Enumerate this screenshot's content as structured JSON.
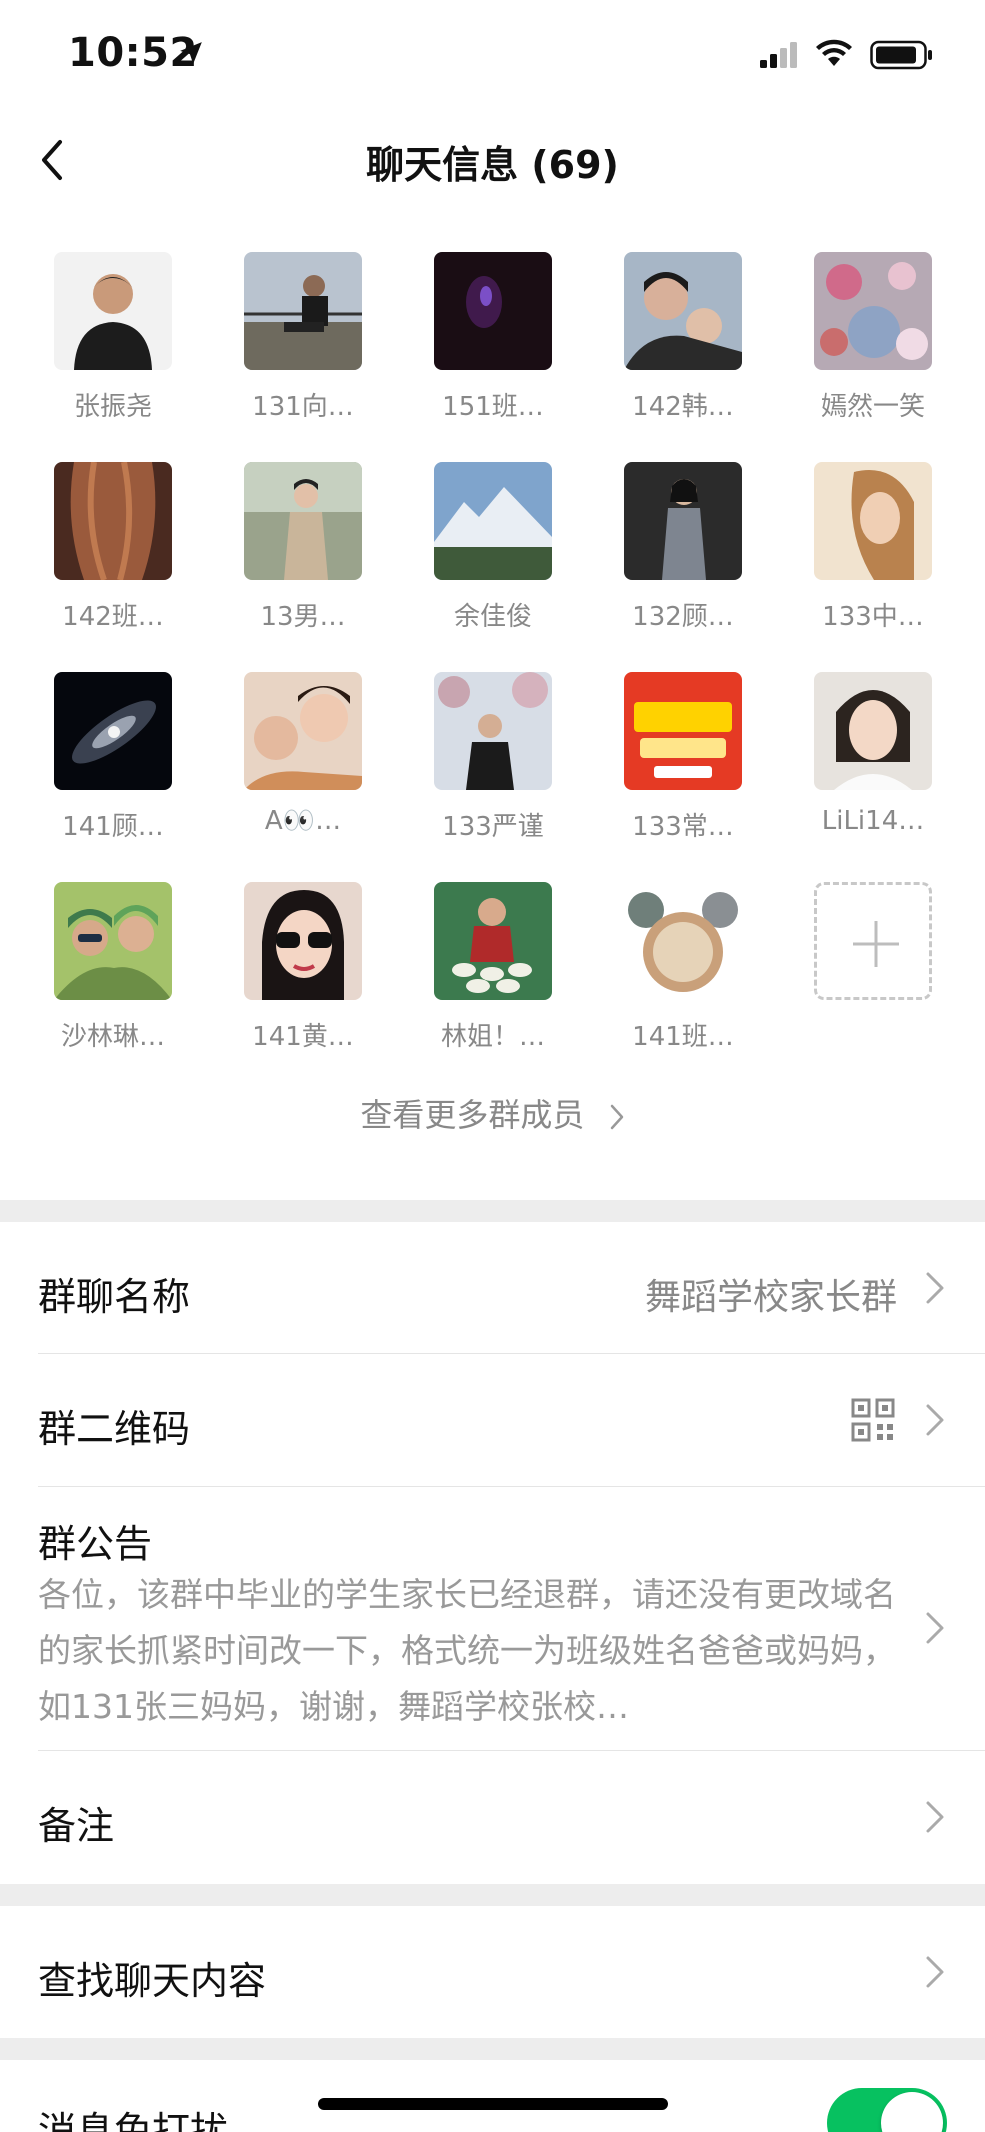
{
  "status_bar": {
    "time": "10:52"
  },
  "header": {
    "title": "聊天信息 (69)"
  },
  "members": [
    {
      "name": "张振尧",
      "avatar": "portrait-man-black-jacket"
    },
    {
      "name": "131向…",
      "avatar": "man-sitting-railing"
    },
    {
      "name": "151班…",
      "avatar": "dark-purple-light"
    },
    {
      "name": "142韩…",
      "avatar": "mother-and-child"
    },
    {
      "name": "嫣然一笑",
      "avatar": "flowers-portrait"
    },
    {
      "name": "142班…",
      "avatar": "long-wavy-hair"
    },
    {
      "name": "13男…",
      "avatar": "woman-outdoors"
    },
    {
      "name": "余佳俊",
      "avatar": "snow-mountain"
    },
    {
      "name": "132顾…",
      "avatar": "woman-gray-dress"
    },
    {
      "name": "133中…",
      "avatar": "smiling-woman"
    },
    {
      "name": "141顾…",
      "avatar": "galaxy"
    },
    {
      "name": "A👀…",
      "avatar": "woman-with-child"
    },
    {
      "name": "133严谨",
      "avatar": "man-under-blossoms"
    },
    {
      "name": "133常…",
      "avatar": "suning-ad-red"
    },
    {
      "name": "LiLi14…",
      "avatar": "woman-selfie"
    },
    {
      "name": "沙林琳…",
      "avatar": "two-women-green"
    },
    {
      "name": "141黄…",
      "avatar": "woman-sunglasses"
    },
    {
      "name": "林姐！…",
      "avatar": "woman-with-dishes"
    },
    {
      "name": "141班…",
      "avatar": "round-collage"
    }
  ],
  "view_more": "查看更多群成员",
  "settings": {
    "group_name_label": "群聊名称",
    "group_name_value": "舞蹈学校家长群",
    "qr_label": "群二维码",
    "announcement_label": "群公告",
    "announcement_text": "各位，该群中毕业的学生家长已经退群，请还没有更改域名的家长抓紧时间改一下，格式统一为班级姓名爸爸或妈妈，如131张三妈妈，谢谢，舞蹈学校张校…",
    "remark_label": "备注",
    "search_label": "查找聊天内容",
    "mute_label": "消息免打扰"
  },
  "colors": {
    "accent": "#07c160",
    "background": "#ededed"
  }
}
